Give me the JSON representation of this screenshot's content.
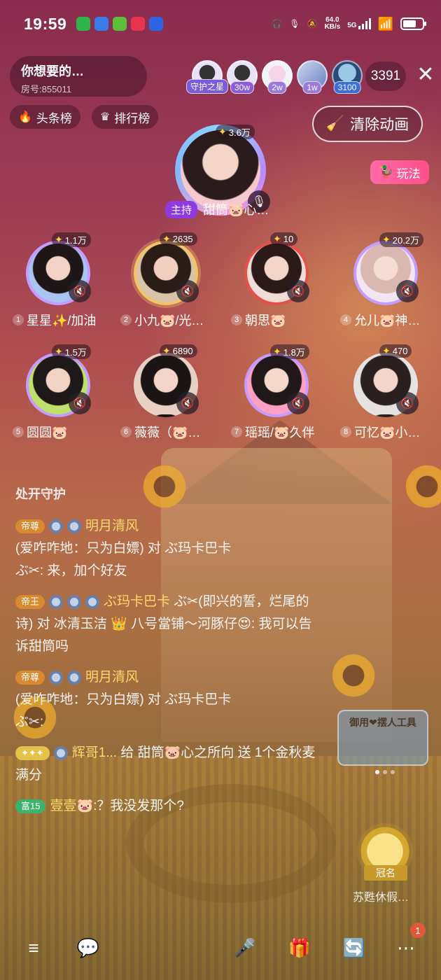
{
  "status_bar": {
    "time": "19:59",
    "net_speed_value": "64.0",
    "net_speed_unit": "KB/s",
    "network": "5G",
    "icons": [
      "wechat-icon",
      "browser-icon",
      "usb-icon",
      "app6-icon",
      "baidu-icon",
      "headphones-icon",
      "mic-icon",
      "mute-bell-icon",
      "signal-icon",
      "wifi-icon",
      "battery-icon"
    ],
    "battery_level": 0.7
  },
  "room": {
    "title": "你想要的…",
    "room_id": "房号:855011"
  },
  "audience": {
    "members": [
      {
        "badge": "守护之星",
        "badge_color": "#7a5cd8"
      },
      {
        "badge": "30w",
        "badge_color": "#8a5cd8"
      },
      {
        "badge": "2w",
        "badge_color": "#9a7ad8"
      },
      {
        "badge": "1w",
        "badge_color": "#9a7ad8"
      },
      {
        "badge": "3100",
        "badge_color": "#3b6fd8"
      }
    ],
    "online_count": "3391",
    "close_icon": "close-icon"
  },
  "ranks": {
    "headline": "头条榜",
    "ranking": "排行榜"
  },
  "actions": {
    "clear_animation": "清除动画",
    "gameplay": "玩法"
  },
  "host": {
    "gift_value": "3.6万",
    "tag": "主持",
    "name": "甜筒🐷心…"
  },
  "seats": [
    {
      "num": "1",
      "name": "星星✨/加油",
      "gift": "1.1万",
      "frame": "purple"
    },
    {
      "num": "2",
      "name": "小九🐷/光…",
      "gift": "2635",
      "frame": "gold"
    },
    {
      "num": "3",
      "name": "朝思🐷",
      "gift": "10",
      "frame": "red"
    },
    {
      "num": "4",
      "name": "允儿🐷神…",
      "gift": "20.2万",
      "frame": "purple"
    },
    {
      "num": "5",
      "name": "圆圆🐷",
      "gift": "1.5万",
      "frame": "purple"
    },
    {
      "num": "6",
      "name": "薇薇（🐷…",
      "gift": "6890",
      "frame": "plain"
    },
    {
      "num": "7",
      "name": "瑶瑶/🐷久伴",
      "gift": "1.8万",
      "frame": "purple"
    },
    {
      "num": "8",
      "name": "可忆🐷小…",
      "gift": "470",
      "frame": "plain"
    }
  ],
  "chat": {
    "system": "处开守护",
    "messages": [
      {
        "level": "帝尊",
        "nick": "明月清风",
        "text": "(爱咋咋地：只为白嫖) 对 ぶ玛卡巴卡",
        "extra": "ぶ✂: 来，加个好友"
      },
      {
        "level": "帝王",
        "nick": "ぶ玛卡巴卡",
        "text": "ぶ✂(即兴的誓，烂尾的诗) 对 冰清玉洁 👑 八号當铺～河豚仔😍: 我可以告诉甜筒吗"
      },
      {
        "level": "帝尊",
        "nick": "明月清风",
        "text": "(爱咋咋地：只为白嫖) 对 ぶ玛卡巴卡",
        "extra": "ぶ✂:"
      },
      {
        "level": "",
        "nick": "辉哥1...",
        "text": "给 甜筒🐷心之所向 送 1个金秋麦满分"
      },
      {
        "level": "富15",
        "nick": "壹壹🐷",
        "text": ":？我没发那个?"
      }
    ]
  },
  "tool_card": {
    "label": "御用❤摆人工具"
  },
  "crown": {
    "tag": "冠名",
    "name": "苏甦休假…"
  },
  "bottom_bar": {
    "notification_count": "1"
  }
}
